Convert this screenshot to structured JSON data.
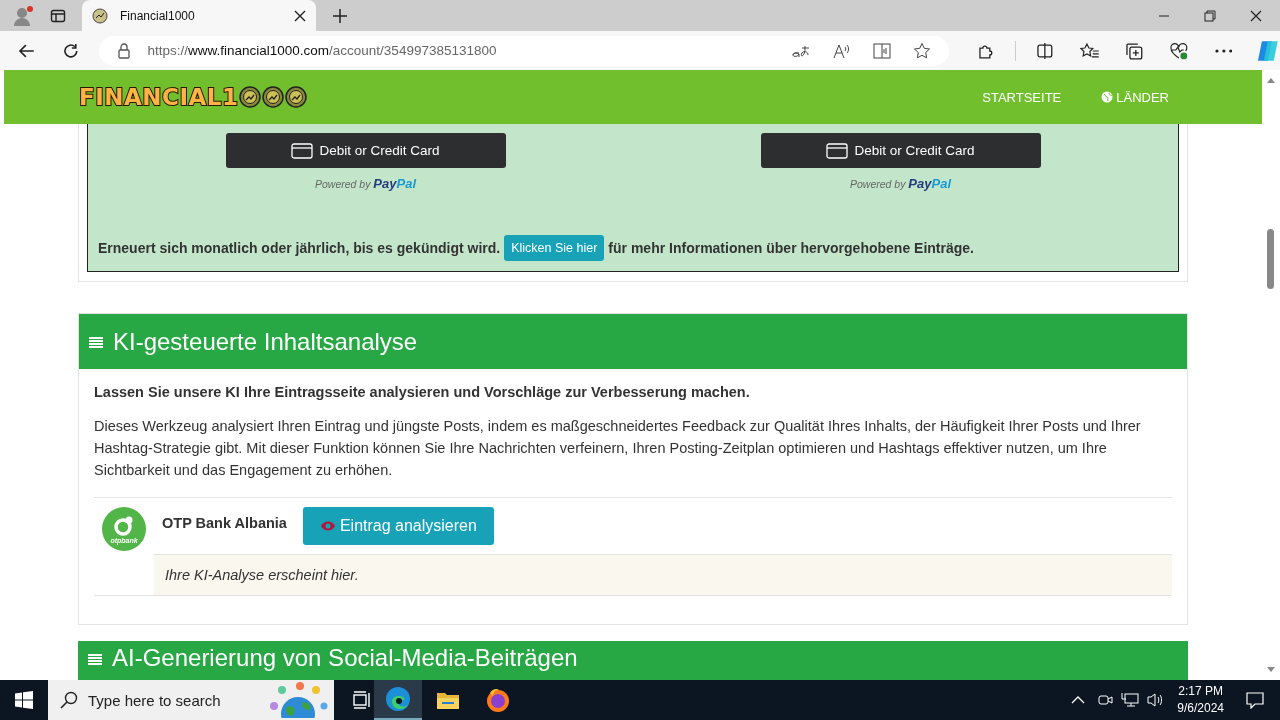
{
  "browser": {
    "tab_title": "Financial1000",
    "url_scheme": "https://",
    "url_host": "www.financial1000.com",
    "url_path": "/account/354997385131800"
  },
  "site_header": {
    "logo_text": "FINANCIAL1",
    "nav": [
      {
        "label": "STARTSEITE",
        "kind": "plain"
      },
      {
        "label": "LÄNDER",
        "kind": "globe"
      }
    ]
  },
  "payment": {
    "buttons": [
      {
        "label": "Debit or Credit Card",
        "powered_by": "Powered by",
        "brand_a": "Pay",
        "brand_b": "Pal"
      },
      {
        "label": "Debit or Credit Card",
        "powered_by": "Powered by",
        "brand_a": "Pay",
        "brand_b": "Pal"
      }
    ],
    "note_before": "Erneuert sich monatlich oder jährlich, bis es gekündigt wird.",
    "note_button": "Klicken Sie hier",
    "note_after": "für mehr Informationen über hervorgehobene Einträge."
  },
  "analysis_section": {
    "title": "KI-gesteuerte Inhaltsanalyse",
    "lead": "Lassen Sie unsere KI Ihre Eintragsseite analysieren und Vorschläge zur Verbesserung machen.",
    "description": "Dieses Werkzeug analysiert Ihren Eintrag und jüngste Posts, indem es maßgeschneidertes Feedback zur Qualität Ihres Inhalts, der Häufigkeit Ihrer Posts und Ihrer Hashtag-Strategie gibt. Mit dieser Funktion können Sie Ihre Nachrichten verfeinern, Ihren Posting-Zeitplan optimieren und Hashtags effektiver nutzen, um Ihre Sichtbarkeit und das Engagement zu erhöhen.",
    "listing": {
      "logo_text": "otpbank",
      "name": "OTP Bank Albania",
      "button": "Eintrag analysieren",
      "result_text": "Ihre KI-Analyse erscheint hier."
    }
  },
  "next_section": {
    "title": "AI-Generierung von Social-Media-Beiträgen"
  },
  "taskbar": {
    "search_placeholder": "Type here to search",
    "time": "2:17 PM",
    "date": "9/6/2024"
  }
}
